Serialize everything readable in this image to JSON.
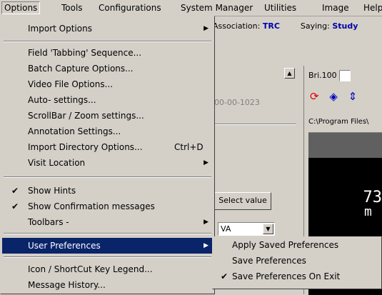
{
  "menubar": {
    "items": [
      "Options",
      "Tools",
      "Configurations",
      "System Manager",
      "Utilities",
      "Image",
      "Help"
    ]
  },
  "background": {
    "association_label": "Association:",
    "association_value": "TRC",
    "saying_label": "Saying:",
    "saying_value": "Study",
    "record_id": "00-00-1023",
    "select_value_button": "Select value",
    "combo_value": "VA",
    "bri_label": "Bri.100",
    "path": "C:\\Program Files\\",
    "viewer_number": "73",
    "viewer_char": "m",
    "icons": [
      "refresh-icon",
      "fit-icon",
      "stretch-icon"
    ],
    "scroll_up_icon": "triangle-up-icon",
    "combo_arrow_icon": "triangle-down-icon"
  },
  "options_menu": {
    "import_options": "Import Options",
    "field_tabbing": "Field 'Tabbing' Sequence...",
    "batch_capture": "Batch Capture Options...",
    "video_file": "Video File Options...",
    "auto_settings": "Auto- settings...",
    "scrollbar_zoom": "ScrollBar / Zoom settings...",
    "annotation": "Annotation Settings...",
    "import_directory": "Import Directory Options...",
    "import_directory_shortcut": "Ctrl+D",
    "visit_location": "Visit Location",
    "show_hints": "Show Hints",
    "show_confirmation": "Show Confirmation messages",
    "toolbars": "Toolbars -",
    "user_preferences": "User Preferences",
    "icon_legend": "Icon / ShortCut Key Legend...",
    "message_history": "Message History..."
  },
  "user_prefs_submenu": {
    "apply_saved": "Apply Saved Preferences",
    "save": "Save Preferences",
    "save_on_exit": "Save Preferences On Exit"
  },
  "colors": {
    "highlight": "#0a246a",
    "face": "#d4d0c8",
    "link_blue": "#0000a8"
  }
}
